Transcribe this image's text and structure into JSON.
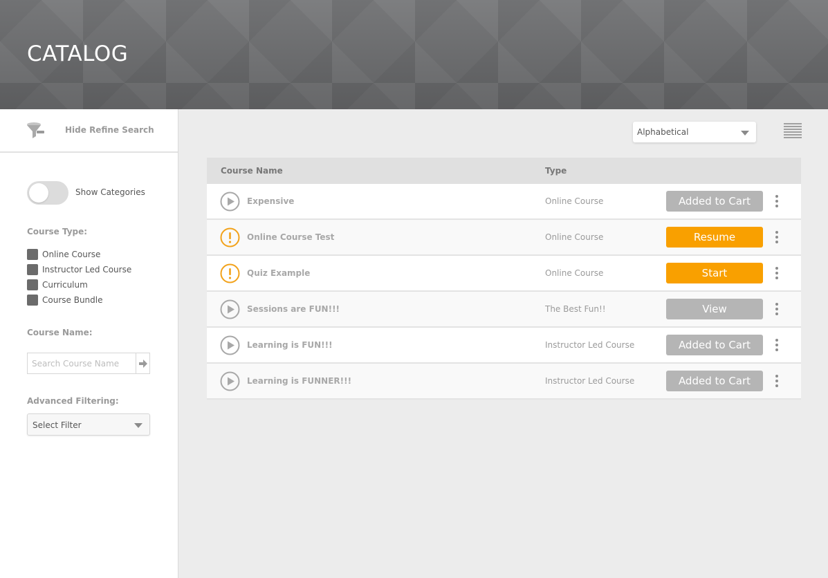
{
  "header": {
    "title": "CATALOG"
  },
  "sidebar": {
    "refine_label": "Hide Refine Search",
    "toggle_label": "Show Categories",
    "course_type_heading": "Course Type:",
    "course_types": [
      "Online Course",
      "Instructor Led Course",
      "Curriculum",
      "Course Bundle"
    ],
    "course_name_heading": "Course Name:",
    "search_placeholder": "Search Course Name",
    "advanced_heading": "Advanced Filtering:",
    "filter_value": "Select Filter"
  },
  "main": {
    "sort_value": "Alphabetical",
    "columns": {
      "name": "Course Name",
      "type": "Type"
    },
    "rows": [
      {
        "name": "Expensive",
        "type": "Online Course",
        "action": "Added to Cart",
        "status_icon": "play-icon",
        "button_color": "gray"
      },
      {
        "name": "Online Course Test",
        "type": "Online Course",
        "action": "Resume",
        "status_icon": "alert-icon",
        "button_color": "orange"
      },
      {
        "name": "Quiz Example",
        "type": "Online Course",
        "action": "Start",
        "status_icon": "alert-icon",
        "button_color": "orange"
      },
      {
        "name": "Sessions are FUN!!!",
        "type": "The Best Fun!!",
        "action": "View",
        "status_icon": "play-icon",
        "button_color": "gray"
      },
      {
        "name": "Learning is FUN!!!",
        "type": "Instructor Led Course",
        "action": "Added to Cart",
        "status_icon": "play-icon",
        "button_color": "gray"
      },
      {
        "name": "Learning is FUNNER!!!",
        "type": "Instructor Led Course",
        "action": "Added to Cart",
        "status_icon": "play-icon",
        "button_color": "gray"
      }
    ]
  },
  "colors": {
    "accent_orange": "#f9a000",
    "button_gray": "#b5b5b5",
    "banner": "#6e6f71"
  }
}
